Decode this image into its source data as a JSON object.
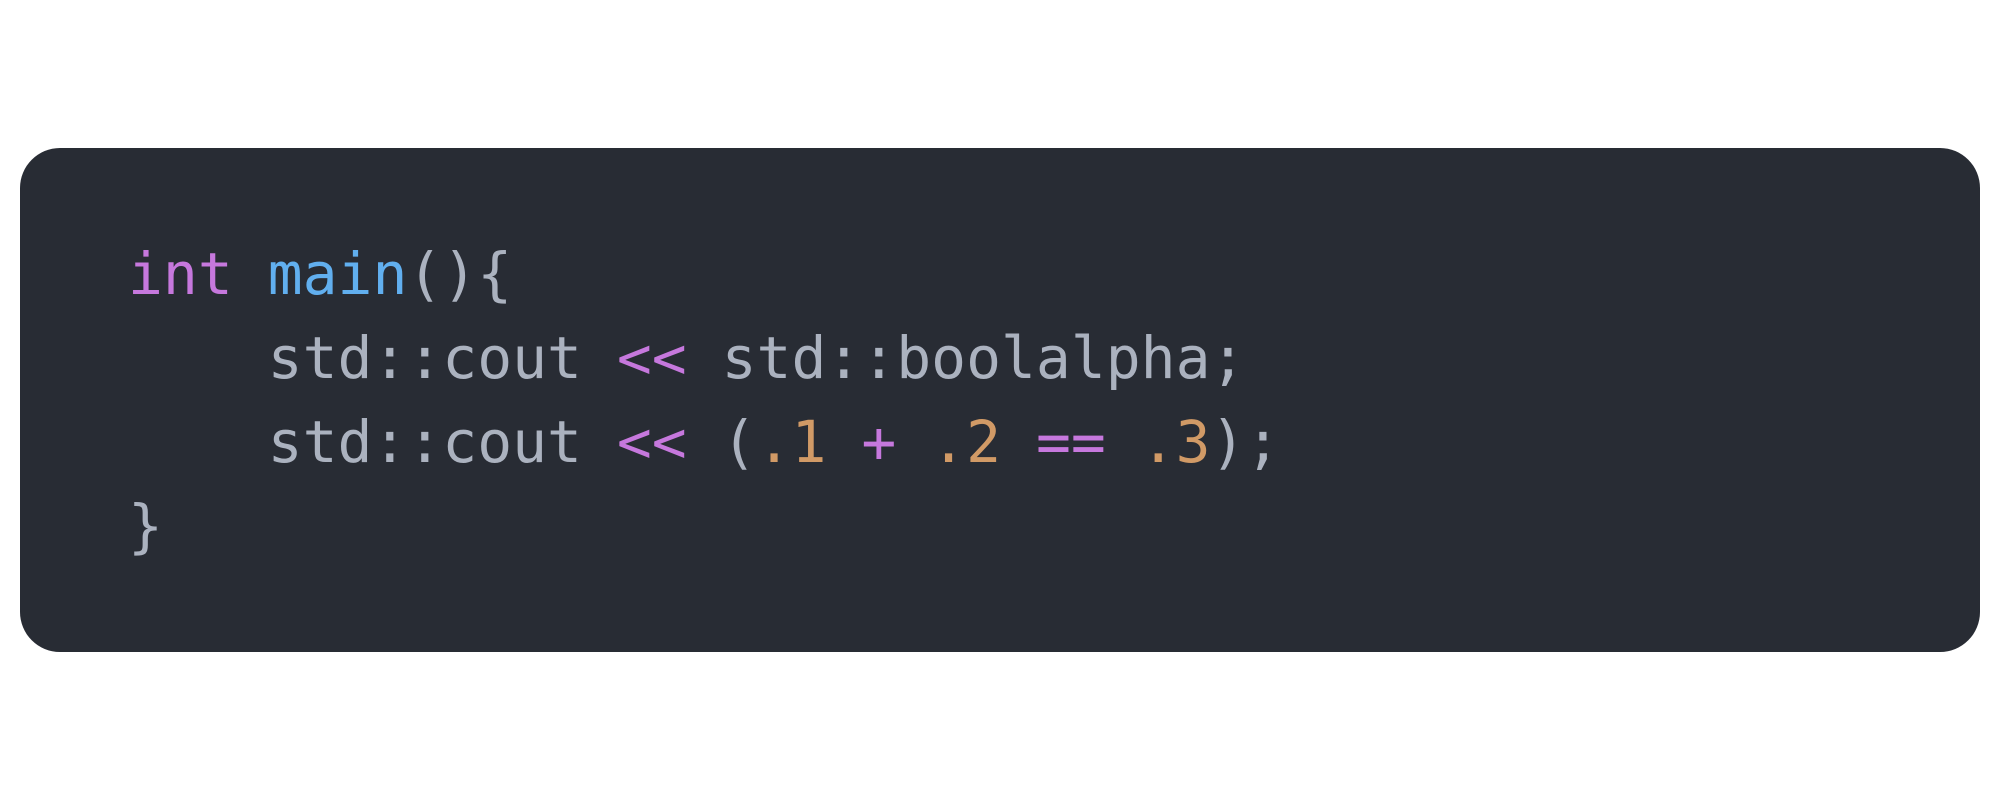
{
  "colors": {
    "background": "#282c34",
    "keyword": "#c678dd",
    "function": "#61afef",
    "operator": "#c678dd",
    "number": "#d19a66",
    "text": "#abb2bf"
  },
  "code": {
    "lines": [
      [
        {
          "t": "int",
          "k": "kw"
        },
        {
          "t": " ",
          "k": "plain"
        },
        {
          "t": "main",
          "k": "fn"
        },
        {
          "t": "(){",
          "k": "plain"
        }
      ],
      [
        {
          "t": "    std::cout ",
          "k": "plain"
        },
        {
          "t": "<<",
          "k": "op"
        },
        {
          "t": " std::boolalpha;",
          "k": "plain"
        }
      ],
      [
        {
          "t": "    std::cout ",
          "k": "plain"
        },
        {
          "t": "<<",
          "k": "op"
        },
        {
          "t": " (",
          "k": "plain"
        },
        {
          "t": ".1",
          "k": "num"
        },
        {
          "t": " ",
          "k": "plain"
        },
        {
          "t": "+",
          "k": "op"
        },
        {
          "t": " ",
          "k": "plain"
        },
        {
          "t": ".2",
          "k": "num"
        },
        {
          "t": " ",
          "k": "plain"
        },
        {
          "t": "==",
          "k": "op"
        },
        {
          "t": " ",
          "k": "plain"
        },
        {
          "t": ".3",
          "k": "num"
        },
        {
          "t": ");",
          "k": "plain"
        }
      ],
      [
        {
          "t": "}",
          "k": "plain"
        }
      ]
    ]
  }
}
